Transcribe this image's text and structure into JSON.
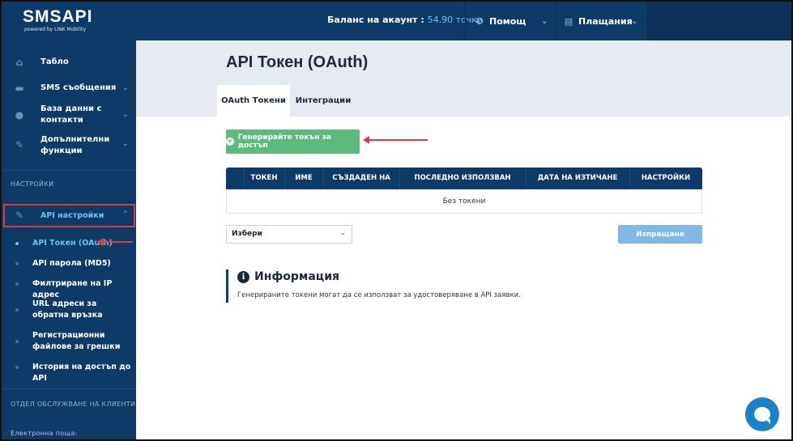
{
  "brand": {
    "logo_text": "SMSAPI",
    "logo_sub": "powered by LINK Mobility"
  },
  "header": {
    "balance_label": "Баланс на акаунт :",
    "balance_value": "54.90 точки",
    "help_label": "Помощ",
    "payments_label": "Плащания"
  },
  "sidebar": {
    "items": [
      {
        "label": "Табло",
        "icon": "home-icon"
      },
      {
        "label": "SMS съобщения",
        "icon": "chat-icon"
      },
      {
        "label": "База данни с контакти",
        "icon": "contacts-icon"
      },
      {
        "label": "Допълнителни функции",
        "icon": "wrench-icon"
      }
    ],
    "settings_section": "НАСТРОЙКИ",
    "api_settings_label": "API настройки",
    "sub_items": [
      "API Токен (OAuth)",
      "API парола (MD5)",
      "Филтриране на IP адрес",
      "URL адреси за обратна връзка",
      "Регистрационни файлове за грешки",
      "История на достъп до API"
    ],
    "support_section": "ОТДЕЛ ОБСЛУЖВАНЕ НА КЛИЕНТИ",
    "email_label": "Електронна поща:"
  },
  "main": {
    "title": "API Токен (OAuth)",
    "tabs": [
      "OAuth Токени",
      "Интеграции"
    ],
    "generate_button": "Генерирайте токън за достъп",
    "table": {
      "columns": [
        "ТОКЕН",
        "ИМЕ",
        "СЪЗДАДЕН НА",
        "ПОСЛЕДНО ИЗПОЛЗВАН",
        "ДАТА НА ИЗТИЧАНЕ",
        "НАСТРОЙКИ"
      ],
      "empty_text": "Без токени"
    },
    "select_value": "Избери",
    "send_button": "Изпращане",
    "info_title": "Информация",
    "info_text": "Генерираните токени могат да се използват за удостоверяване в API заявки."
  },
  "colors": {
    "sidebar_bg": "#0e3a68",
    "accent_blue": "#6ec1f0",
    "green_button": "#5cba7d",
    "send_button": "#7fb8e6",
    "annotation_red": "#e03a3a"
  }
}
